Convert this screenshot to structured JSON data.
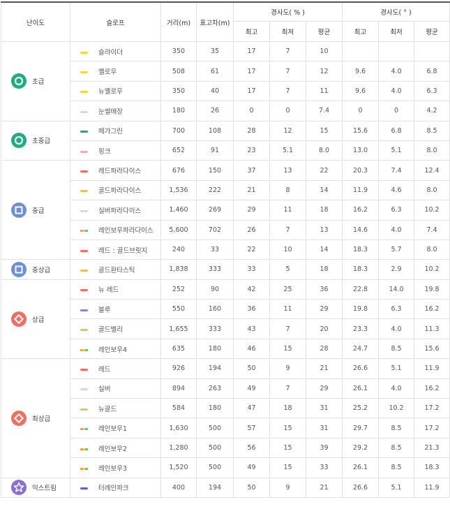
{
  "header": {
    "level": "난이도",
    "slope": "슬로프",
    "distance": "거리(m)",
    "elevation": "표고차(m)",
    "grade_percent": "경사도( % )",
    "grade_degree": "경사도( ° )",
    "max": "최고",
    "min": "최저",
    "avg": "평균"
  },
  "colors": {
    "green": "#1aaf7e",
    "blue": "#6c8fd8",
    "red": "#ef6f60",
    "purple": "#8a6fd1"
  },
  "groups": [
    {
      "level": "초급",
      "icon": "circle-icon",
      "color": "#1aaf7e",
      "rows": [
        {
          "name": "슬라이더",
          "swatch": [
            "#f5d63a"
          ],
          "distance": "350",
          "elevation": "35",
          "p_max": "17",
          "p_min": "7",
          "p_avg": "10",
          "d_max": "",
          "d_min": "",
          "d_avg": ""
        },
        {
          "name": "옐로우",
          "swatch": [
            "#f5d63a"
          ],
          "distance": "508",
          "elevation": "61",
          "p_max": "17",
          "p_min": "7",
          "p_avg": "12",
          "d_max": "9.6",
          "d_min": "4.0",
          "d_avg": "6.8"
        },
        {
          "name": "뉴옐로우",
          "swatch": [
            "#f5d63a"
          ],
          "distance": "350",
          "elevation": "40",
          "p_max": "17",
          "p_min": "7",
          "p_avg": "11",
          "d_max": "9.6",
          "d_min": "4.0",
          "d_avg": "6.3"
        },
        {
          "name": "눈썰매장",
          "swatch": [
            "#d8d8e4"
          ],
          "distance": "180",
          "elevation": "26",
          "p_max": "0",
          "p_min": "0",
          "p_avg": "7.4",
          "d_max": "0",
          "d_min": "0",
          "d_avg": "4.2"
        }
      ]
    },
    {
      "level": "초중급",
      "icon": "circle-icon",
      "color": "#1aaf7e",
      "rows": [
        {
          "name": "메가그린",
          "swatch": [
            "#1aaf7e"
          ],
          "distance": "700",
          "elevation": "108",
          "p_max": "28",
          "p_min": "12",
          "p_avg": "15",
          "d_max": "15.6",
          "d_min": "6.8",
          "d_avg": "8.5"
        },
        {
          "name": "핑크",
          "swatch": [
            "#f5a9c0"
          ],
          "distance": "652",
          "elevation": "91",
          "p_max": "23",
          "p_min": "5.1",
          "p_avg": "8.0",
          "d_max": "13.0",
          "d_min": "5.1",
          "d_avg": "8.0"
        }
      ]
    },
    {
      "level": "중급",
      "icon": "square-icon",
      "color": "#6c8fd8",
      "rows": [
        {
          "name": "레드파라다이스",
          "swatch": [
            "#ef6f60"
          ],
          "distance": "676",
          "elevation": "150",
          "p_max": "37",
          "p_min": "13",
          "p_avg": "22",
          "d_max": "20.3",
          "d_min": "7.4",
          "d_avg": "12.4"
        },
        {
          "name": "골드파라다이스",
          "swatch": [
            "#e4c15a"
          ],
          "distance": "1,536",
          "elevation": "222",
          "p_max": "21",
          "p_min": "8",
          "p_avg": "14",
          "d_max": "11.9",
          "d_min": "4.6",
          "d_avg": "8.0"
        },
        {
          "name": "실버파라다이스",
          "swatch": [
            "#d8d8e4"
          ],
          "distance": "1,460",
          "elevation": "269",
          "p_max": "29",
          "p_min": "11",
          "p_avg": "18",
          "d_max": "16.2",
          "d_min": "6.3",
          "d_avg": "10.2"
        },
        {
          "name": "레인보우파라다이스",
          "swatch": [
            "#ef6f60",
            "#f5d63a",
            "#1aaf7e"
          ],
          "distance": "5,600",
          "elevation": "702",
          "p_max": "26",
          "p_min": "7",
          "p_avg": "13",
          "d_max": "14.6",
          "d_min": "4.0",
          "d_avg": "7.4"
        },
        {
          "name": "레드 : 골드브릿지",
          "swatch": [
            "#ef6f60"
          ],
          "distance": "240",
          "elevation": "33",
          "p_max": "22",
          "p_min": "10",
          "p_avg": "14",
          "d_max": "18.3",
          "d_min": "5.7",
          "d_avg": "8.0"
        }
      ]
    },
    {
      "level": "중상급",
      "icon": "square-icon",
      "color": "#6c8fd8",
      "rows": [
        {
          "name": "골드환타스틱",
          "swatch": [
            "#e4c15a"
          ],
          "distance": "1,838",
          "elevation": "333",
          "p_max": "33",
          "p_min": "5",
          "p_avg": "18",
          "d_max": "18.3",
          "d_min": "2.9",
          "d_avg": "10.2"
        }
      ]
    },
    {
      "level": "상급",
      "icon": "diamond-icon",
      "color": "#ef6f60",
      "rows": [
        {
          "name": "뉴 레드",
          "swatch": [
            "#ef6f60"
          ],
          "distance": "252",
          "elevation": "90",
          "p_max": "42",
          "p_min": "25",
          "p_avg": "36",
          "d_max": "22.8",
          "d_min": "14.0",
          "d_avg": "19.8"
        },
        {
          "name": "블루",
          "swatch": [
            "#6c8fd8"
          ],
          "distance": "550",
          "elevation": "160",
          "p_max": "36",
          "p_min": "11",
          "p_avg": "29",
          "d_max": "19.8",
          "d_min": "6.3",
          "d_avg": "16.2"
        },
        {
          "name": "골드밸리",
          "swatch": [
            "#e4c15a"
          ],
          "distance": "1,655",
          "elevation": "333",
          "p_max": "43",
          "p_min": "7",
          "p_avg": "20",
          "d_max": "23.3",
          "d_min": "4.0",
          "d_avg": "11.3"
        },
        {
          "name": "레인보우4",
          "swatch": [
            "#ef6f60",
            "#f5d63a",
            "#1aaf7e"
          ],
          "distance": "635",
          "elevation": "180",
          "p_max": "46",
          "p_min": "15",
          "p_avg": "28",
          "d_max": "24.7",
          "d_min": "8.5",
          "d_avg": "15.6"
        }
      ]
    },
    {
      "level": "최상급",
      "icon": "diamond-icon",
      "color": "#ef6f60",
      "rows": [
        {
          "name": "레드",
          "swatch": [
            "#ef6f60"
          ],
          "distance": "926",
          "elevation": "194",
          "p_max": "50",
          "p_min": "9",
          "p_avg": "21",
          "d_max": "26.6",
          "d_min": "5.1",
          "d_avg": "11.9"
        },
        {
          "name": "실버",
          "swatch": [
            "#d8d8e4"
          ],
          "distance": "894",
          "elevation": "263",
          "p_max": "49",
          "p_min": "7",
          "p_avg": "29",
          "d_max": "26.1",
          "d_min": "4.0",
          "d_avg": "16.2"
        },
        {
          "name": "뉴골드",
          "swatch": [
            "#e4c15a"
          ],
          "distance": "584",
          "elevation": "180",
          "p_max": "47",
          "p_min": "18",
          "p_avg": "31",
          "d_max": "25.2",
          "d_min": "10.2",
          "d_avg": "17.2"
        },
        {
          "name": "레인보우1",
          "swatch": [
            "#ef6f60",
            "#f5d63a",
            "#1aaf7e"
          ],
          "distance": "1,630",
          "elevation": "500",
          "p_max": "57",
          "p_min": "15",
          "p_avg": "31",
          "d_max": "29.7",
          "d_min": "8.5",
          "d_avg": "17.2"
        },
        {
          "name": "레인보우2",
          "swatch": [
            "#ef6f60",
            "#f5d63a",
            "#1aaf7e"
          ],
          "distance": "1,280",
          "elevation": "500",
          "p_max": "56",
          "p_min": "15",
          "p_avg": "39",
          "d_max": "29.2",
          "d_min": "8.5",
          "d_avg": "21.3"
        },
        {
          "name": "레인보우3",
          "swatch": [
            "#ef6f60",
            "#f5d63a",
            "#1aaf7e"
          ],
          "distance": "1,520",
          "elevation": "500",
          "p_max": "49",
          "p_min": "15",
          "p_avg": "33",
          "d_max": "26.1",
          "d_min": "8.5",
          "d_avg": "18.3"
        }
      ]
    },
    {
      "level": "익스트림",
      "icon": "star-icon",
      "color": "#8a6fd1",
      "rows": [
        {
          "name": "터레인파크",
          "swatch": [
            "#6b57d6"
          ],
          "distance": "400",
          "elevation": "194",
          "p_max": "50",
          "p_min": "9",
          "p_avg": "21",
          "d_max": "26.6",
          "d_min": "5.1",
          "d_avg": "11.9"
        }
      ]
    }
  ]
}
